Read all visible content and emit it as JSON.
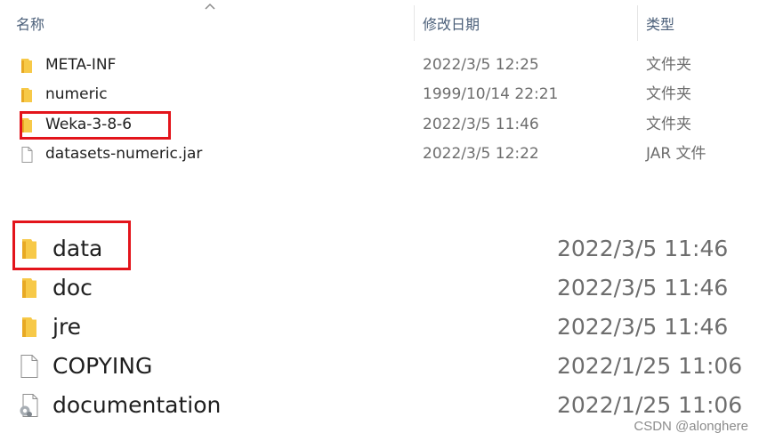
{
  "explorer": {
    "columns": {
      "name": "名称",
      "date_modified": "修改日期",
      "type": "类型"
    },
    "sort_indicator": "chevron-up-icon",
    "rows": [
      {
        "name": "META-INF",
        "date": "2022/3/5 12:25",
        "type": "文件夹",
        "icon": "folder-icon"
      },
      {
        "name": "numeric",
        "date": "1999/10/14 22:21",
        "type": "文件夹",
        "icon": "folder-icon"
      },
      {
        "name": "Weka-3-8-6",
        "date": "2022/3/5 11:46",
        "type": "文件夹",
        "icon": "folder-icon",
        "highlighted": true
      },
      {
        "name": "datasets-numeric.jar",
        "date": "2022/3/5 12:22",
        "type": "JAR 文件",
        "icon": "file-icon"
      }
    ]
  },
  "weka_folder": {
    "rows": [
      {
        "name": "data",
        "date": "2022/3/5 11:46",
        "icon": "folder-icon",
        "highlighted": true
      },
      {
        "name": "doc",
        "date": "2022/3/5 11:46",
        "icon": "folder-icon"
      },
      {
        "name": "jre",
        "date": "2022/3/5 11:46",
        "icon": "folder-icon"
      },
      {
        "name": "COPYING",
        "date": "2022/1/25 11:06",
        "icon": "file-icon"
      },
      {
        "name": "documentation",
        "date": "2022/1/25 11:06",
        "icon": "settings-file-icon"
      }
    ]
  },
  "watermark": "CSDN @alonghere",
  "colors": {
    "highlight": "#e3141b",
    "folder": "#f7c948",
    "header_text": "#4c607a",
    "meta_text": "#6d6d6d"
  }
}
